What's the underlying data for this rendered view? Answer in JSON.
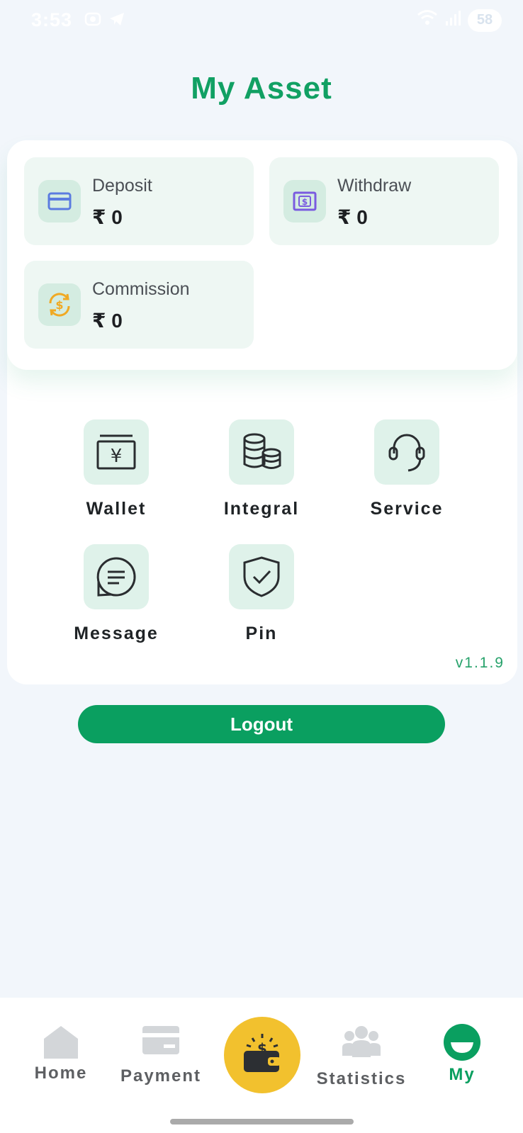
{
  "status_bar": {
    "time": "3:53",
    "battery": "58"
  },
  "header": {
    "title": "My Asset"
  },
  "assets": [
    {
      "label": "Deposit",
      "value": "₹ 0",
      "icon": "card-icon"
    },
    {
      "label": "Withdraw",
      "value": "₹ 0",
      "icon": "cash-icon"
    },
    {
      "label": "Commission",
      "value": "₹ 0",
      "icon": "exchange-icon"
    }
  ],
  "menu": [
    {
      "label": "Wallet",
      "icon": "wallet-icon"
    },
    {
      "label": "Integral",
      "icon": "coins-icon"
    },
    {
      "label": "Service",
      "icon": "headset-icon"
    },
    {
      "label": "Message",
      "icon": "message-icon"
    },
    {
      "label": "Pin",
      "icon": "shield-check-icon"
    }
  ],
  "version": "v1.1.9",
  "logout_label": "Logout",
  "tabs": [
    {
      "label": "Home",
      "icon": "home-icon",
      "active": false
    },
    {
      "label": "Payment",
      "icon": "payment-card-icon",
      "active": false
    },
    {
      "label": "",
      "icon": "wallet-dollar-icon",
      "active": false
    },
    {
      "label": "Statistics",
      "icon": "people-icon",
      "active": false
    },
    {
      "label": "My",
      "icon": "profile-icon",
      "active": true
    }
  ],
  "colors": {
    "brand": "#0a9f60",
    "title": "#11a063",
    "center_button": "#f2c12e",
    "page_bg": "#f2f6fb"
  }
}
